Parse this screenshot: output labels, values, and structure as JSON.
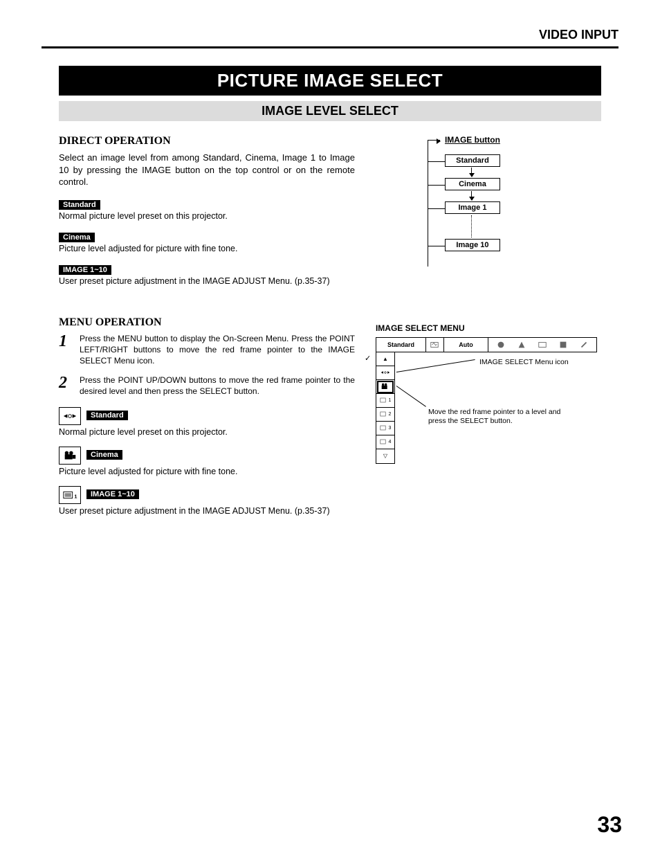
{
  "header": "VIDEO INPUT",
  "title": "PICTURE IMAGE SELECT",
  "subtitle": "IMAGE LEVEL SELECT",
  "direct": {
    "heading": "DIRECT OPERATION",
    "intro": "Select an image level from among Standard, Cinema, Image 1 to Image 10 by pressing the IMAGE button on the top control or on the remote control.",
    "items": [
      {
        "label": "Standard",
        "desc": "Normal picture level preset on this projector."
      },
      {
        "label": "Cinema",
        "desc": "Picture level adjusted for picture with fine tone."
      },
      {
        "label": "IMAGE 1~10",
        "desc": "User preset picture adjustment in the IMAGE ADJUST Menu. (p.35-37)"
      }
    ]
  },
  "menu": {
    "heading": "MENU OPERATION",
    "steps": [
      "Press the MENU button to display the On-Screen Menu. Press the POINT LEFT/RIGHT buttons to move the red frame pointer to the IMAGE SELECT Menu icon.",
      "Press the POINT UP/DOWN buttons to move the red frame pointer to the desired level and then press the SELECT button."
    ],
    "items": [
      {
        "label": "Standard",
        "desc": "Normal picture level preset on this projector."
      },
      {
        "label": "Cinema",
        "desc": "Picture level adjusted for picture with fine tone."
      },
      {
        "label": "IMAGE 1~10",
        "desc": "User preset picture adjustment in the IMAGE ADJUST Menu. (p.35-37)"
      }
    ]
  },
  "diagram": {
    "title": "IMAGE button",
    "boxes": [
      "Standard",
      "Cinema",
      "Image 1",
      "Image 10"
    ]
  },
  "selectMenu": {
    "heading": "IMAGE SELECT MENU",
    "bar": {
      "standard": "Standard",
      "auto": "Auto"
    },
    "sideLabels": [
      "▲",
      "",
      "",
      "1",
      "2",
      "3",
      "4",
      "▽"
    ],
    "callout1": "IMAGE SELECT Menu icon",
    "callout2": "Move the red frame pointer to a level and press the SELECT button."
  },
  "pageNumber": "33"
}
